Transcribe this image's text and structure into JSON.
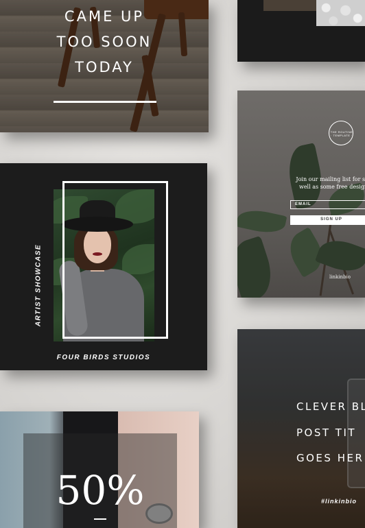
{
  "chair_card": {
    "title_lines": [
      "CAME UP",
      "TOO SOON",
      "TODAY"
    ]
  },
  "artist_card": {
    "vertical_label": "ARTIST SHOWCASE",
    "studio_label": "FOUR BIRDS STUDIOS"
  },
  "mail_card": {
    "badge_text": "THE ROUTINE · TEMPLATE ·",
    "message_lines": [
      "Join our mailing list for studio u",
      "well as some free design reso"
    ],
    "email_placeholder": "EMAIL",
    "signup_label": "SIGN UP",
    "link_text": "linkinbio"
  },
  "fifty_card": {
    "value": "50%"
  },
  "clever_card": {
    "lines": [
      "CLEVER BL",
      "POST TIT",
      "GOES HER"
    ],
    "hashtag": "#linkinbio"
  }
}
